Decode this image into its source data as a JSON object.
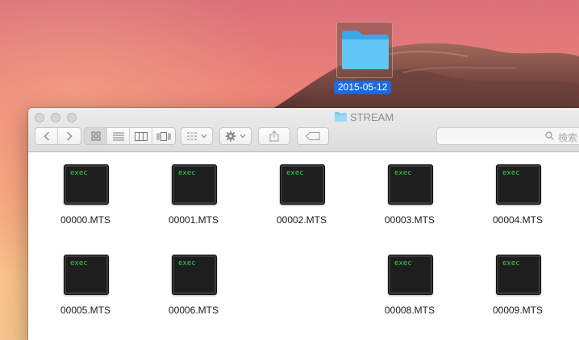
{
  "desktop": {
    "folder_label": "2015-05-12"
  },
  "window": {
    "title": "STREAM",
    "toolbar": {
      "back_icon": "chevron-left-icon",
      "forward_icon": "chevron-right-icon",
      "view_modes": [
        "icon-view",
        "list-view",
        "column-view",
        "cover-flow-view"
      ],
      "active_view": "icon-view",
      "search_placeholder": "検索"
    }
  },
  "files": [
    {
      "name": "00000.MTS",
      "badge": "exec"
    },
    {
      "name": "00001.MTS",
      "badge": "exec"
    },
    {
      "name": "00002.MTS",
      "badge": "exec"
    },
    {
      "name": "00003.MTS",
      "badge": "exec"
    },
    {
      "name": "00004.MTS",
      "badge": "exec"
    },
    {
      "name": "00005.MTS",
      "badge": "exec"
    },
    {
      "name": "00006.MTS",
      "badge": "exec"
    },
    {
      "name": "00008.MTS",
      "badge": "exec"
    },
    {
      "name": "00009.MTS",
      "badge": "exec"
    }
  ],
  "colors": {
    "selection_blue": "#1e6adf",
    "folder_blue": "#5bc2f5",
    "exec_green": "#37d04b"
  }
}
